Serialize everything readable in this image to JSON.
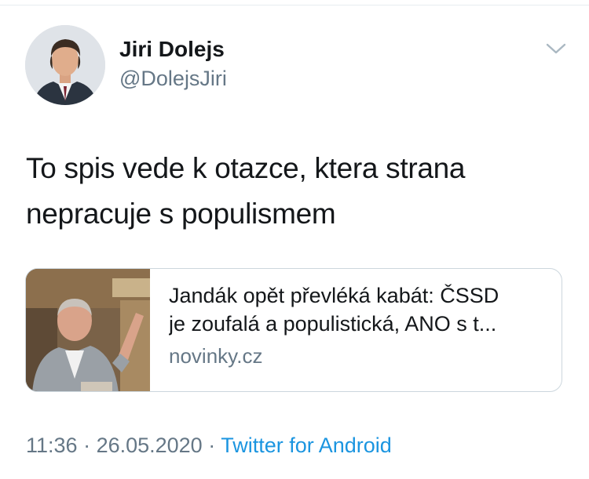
{
  "author": {
    "display_name": "Jiri Dolejs",
    "handle": "@DolejsJiri"
  },
  "tweet": {
    "text_line1": "To spis vede k otazce, ktera strana",
    "text_line2": "nepracuje s populismem"
  },
  "link_card": {
    "title_line1": "Jandák opět převléká kabát: ČSSD",
    "title_line2": "je zoufalá a populistická, ANO s t...",
    "domain": "novinky.cz"
  },
  "meta": {
    "time": "11:36",
    "separator1": " · ",
    "date": "26.05.2020",
    "separator2": " · ",
    "source": "Twitter for Android"
  },
  "colors": {
    "text": "#14171a",
    "secondary": "#657786",
    "link": "#1b95e0",
    "border": "#ccd6dd"
  },
  "icons": {
    "menu": "chevron-down-icon"
  }
}
